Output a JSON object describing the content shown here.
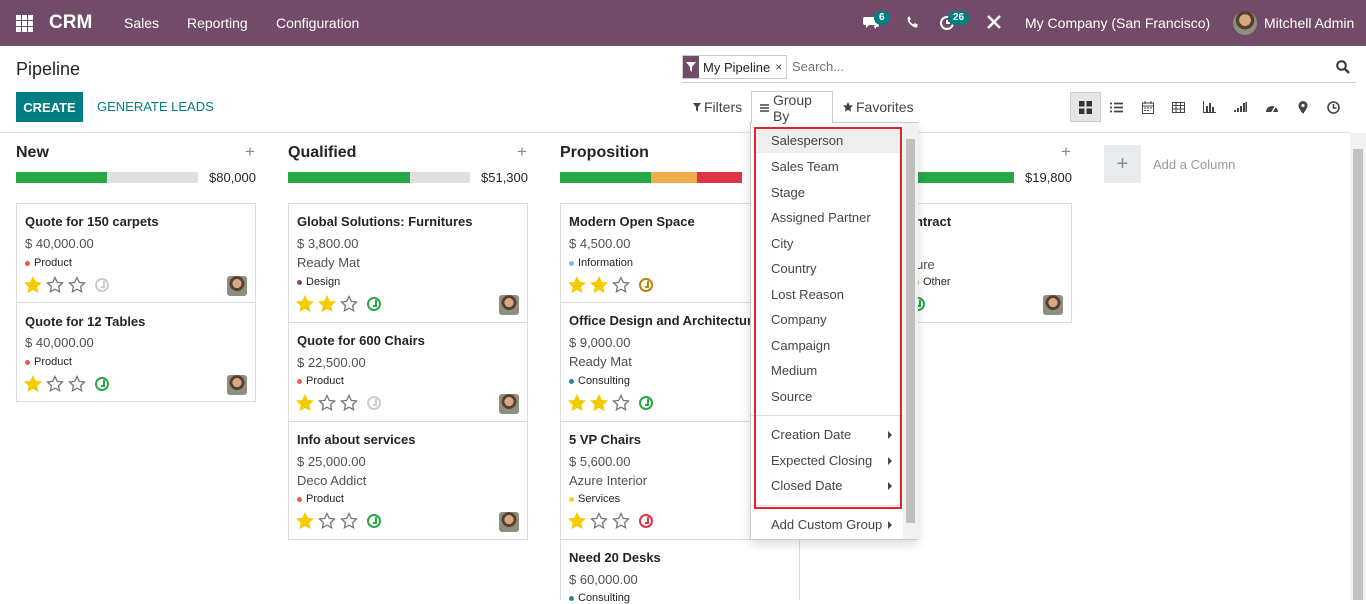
{
  "topbar": {
    "brand": "CRM",
    "menu": [
      "Sales",
      "Reporting",
      "Configuration"
    ],
    "messages_badge": "6",
    "activities_badge": "26",
    "company": "My Company (San Francisco)",
    "user": "Mitchell Admin",
    "color": "#714B67"
  },
  "control_panel": {
    "title": "Pipeline",
    "facet_label": "My Pipeline",
    "facet_remove": "×",
    "search_placeholder": "Search...",
    "create_label": "CREATE",
    "generate_label": "GENERATE LEADS",
    "filters_label": "Filters",
    "groupby_label": "Group By",
    "favorites_label": "Favorites",
    "views": [
      "kanban-icon",
      "list-icon",
      "calendar-icon",
      "pivot-icon",
      "graph-icon",
      "cohort-icon",
      "dashboard-icon",
      "map-icon",
      "activity-icon"
    ]
  },
  "columns": [
    {
      "title": "New",
      "amount": "$80,000",
      "progress": [
        {
          "color": "#28a745",
          "fraction": 0.5
        }
      ]
    },
    {
      "title": "Qualified",
      "amount": "$51,300",
      "progress": [
        {
          "color": "#28a745",
          "fraction": 0.67
        }
      ]
    },
    {
      "title": "Proposition",
      "amount": "",
      "progress": [
        {
          "color": "#28a745",
          "fraction": 0.5
        },
        {
          "color": "#f0ad4e",
          "fraction": 0.25
        },
        {
          "color": "#dc3545",
          "fraction": 0.25
        }
      ]
    },
    {
      "title": "",
      "amount": "$19,800",
      "progress": [
        {
          "color": "#28a745",
          "fraction": 1.0
        }
      ]
    }
  ],
  "cards": {
    "new": [
      {
        "title": "Quote for 150 carpets",
        "amount": "$ 40,000.00",
        "tag": "Product",
        "tag_color": "#e85d4b",
        "stars": 1,
        "activity_color": "#cccccc"
      },
      {
        "title": "Quote for 12 Tables",
        "amount": "$ 40,000.00",
        "tag": "Product",
        "tag_color": "#e85d4b",
        "stars": 1,
        "activity_color": "#28a745"
      }
    ],
    "qualified": [
      {
        "title": "Global Solutions: Furnitures",
        "amount": "$ 3,800.00",
        "partner": "Ready Mat",
        "tag": "Design",
        "tag_color": "#8e4464",
        "stars": 2,
        "activity_color": "#28a745"
      },
      {
        "title": "Quote for 600 Chairs",
        "amount": "$ 22,500.00",
        "tag": "Product",
        "tag_color": "#e85d4b",
        "stars": 1,
        "activity_color": "#cccccc"
      },
      {
        "title": "Info about services",
        "amount": "$ 25,000.00",
        "partner": "Deco Addict",
        "tag": "Product",
        "tag_color": "#e85d4b",
        "stars": 1,
        "activity_color": "#28a745"
      }
    ],
    "proposition": [
      {
        "title": "Modern Open Space",
        "amount": "$ 4,500.00",
        "tag": "Information",
        "tag_color": "#6cc1ed",
        "stars": 2,
        "activity_color": "#b8860b"
      },
      {
        "title": "Office Design and Architecture",
        "amount": "$ 9,000.00",
        "partner": "Ready Mat",
        "tag": "Consulting",
        "tag_color": "#2c8397",
        "stars": 2,
        "activity_color": "#28a745"
      },
      {
        "title": "5 VP Chairs",
        "amount": "$ 5,600.00",
        "partner": "Azure Interior",
        "tag": "Services",
        "tag_color": "#f3d02b",
        "stars": 1,
        "activity_color": "#dc3545"
      },
      {
        "title": "Need 20 Desks",
        "amount": "$ 60,000.00",
        "tag": "Consulting",
        "tag_color": "#2c8397"
      }
    ],
    "won": [
      {
        "title": "ontract",
        "partner": "ure",
        "tag": "Other",
        "tag_color": "#f0a060",
        "activity_color": "#28a745"
      }
    ]
  },
  "add_column": {
    "plus": "+",
    "label": "Add a Column"
  },
  "groupby_menu": {
    "fields": [
      "Salesperson",
      "Sales Team",
      "Stage",
      "Assigned Partner",
      "City",
      "Country",
      "Lost Reason",
      "Company",
      "Campaign",
      "Medium",
      "Source"
    ],
    "dates": [
      "Creation Date",
      "Expected Closing",
      "Closed Date"
    ],
    "custom": "Add Custom Group"
  }
}
